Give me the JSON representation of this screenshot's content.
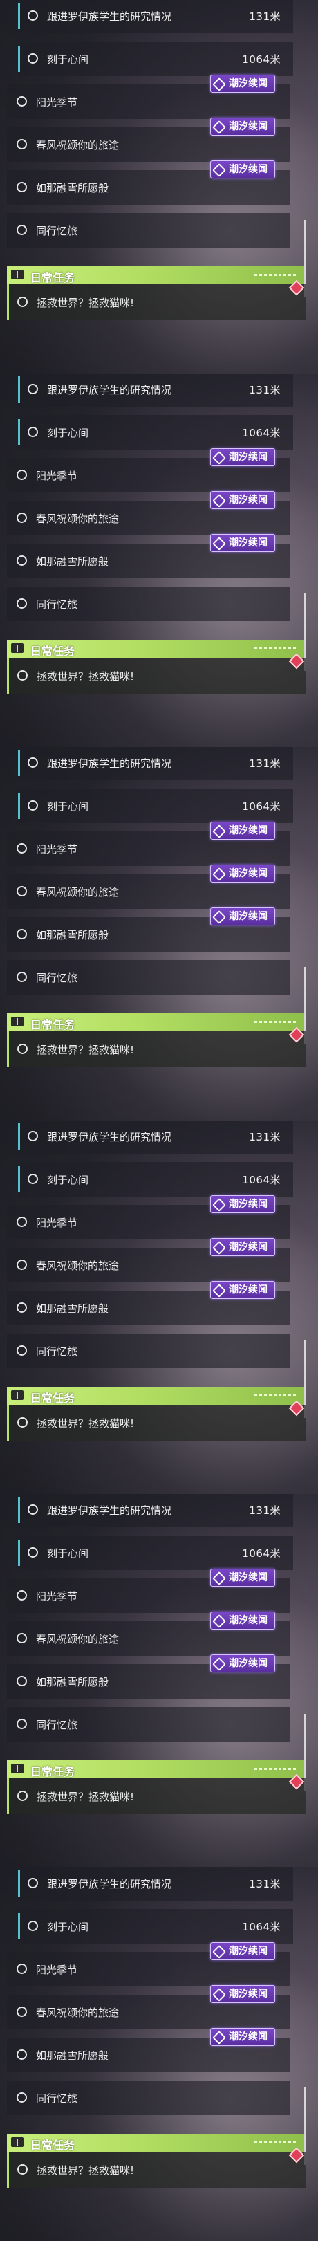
{
  "panels": [
    {
      "quests": [
        {
          "name": "跟进罗伊族学生的研究情况",
          "distance": "131米"
        },
        {
          "name": "刻于心间",
          "distance": "1064米"
        },
        {
          "name": "阳光季节"
        },
        {
          "name": "春风祝颂你的旅途"
        },
        {
          "name": "如那融雪所愿般"
        },
        {
          "name": "同行忆旅"
        }
      ],
      "badges": [
        "潮汐续闻",
        "潮汐续闻",
        "潮汐续闻"
      ],
      "daily": {
        "title": "日常任务",
        "task": "拯救世界？拯救猫咪!"
      }
    },
    {
      "quests": [
        {
          "name": "跟进罗伊族学生的研究情况",
          "distance": "131米"
        },
        {
          "name": "刻于心间",
          "distance": "1064米"
        },
        {
          "name": "阳光季节"
        },
        {
          "name": "春风祝颂你的旅途"
        },
        {
          "name": "如那融雪所愿般"
        },
        {
          "name": "同行忆旅"
        }
      ],
      "badges": [
        "潮汐续闻",
        "潮汐续闻",
        "潮汐续闻"
      ],
      "daily": {
        "title": "日常任务",
        "task": "拯救世界？拯救猫咪!"
      }
    },
    {
      "quests": [
        {
          "name": "跟进罗伊族学生的研究情况",
          "distance": "131米"
        },
        {
          "name": "刻于心间",
          "distance": "1064米"
        },
        {
          "name": "阳光季节"
        },
        {
          "name": "春风祝颂你的旅途"
        },
        {
          "name": "如那融雪所愿般"
        },
        {
          "name": "同行忆旅"
        }
      ],
      "badges": [
        "潮汐续闻",
        "潮汐续闻",
        "潮汐续闻"
      ],
      "daily": {
        "title": "日常任务",
        "task": "拯救世界？拯救猫咪!"
      }
    },
    {
      "quests": [
        {
          "name": "跟进罗伊族学生的研究情况",
          "distance": "131米"
        },
        {
          "name": "刻于心间",
          "distance": "1064米"
        },
        {
          "name": "阳光季节"
        },
        {
          "name": "春风祝颂你的旅途"
        },
        {
          "name": "如那融雪所愿般"
        },
        {
          "name": "同行忆旅"
        }
      ],
      "badges": [
        "潮汐续闻",
        "潮汐续闻",
        "潮汐续闻"
      ],
      "daily": {
        "title": "日常任务",
        "task": "拯救世界？拯救猫咪!"
      }
    },
    {
      "quests": [
        {
          "name": "跟进罗伊族学生的研究情况",
          "distance": "131米"
        },
        {
          "name": "刻于心间",
          "distance": "1064米"
        },
        {
          "name": "阳光季节"
        },
        {
          "name": "春风祝颂你的旅途"
        },
        {
          "name": "如那融雪所愿般"
        },
        {
          "name": "同行忆旅"
        }
      ],
      "badges": [
        "潮汐续闻",
        "潮汐续闻",
        "潮汐续闻"
      ],
      "daily": {
        "title": "日常任务",
        "task": "拯救世界？拯救猫咪!"
      }
    },
    {
      "quests": [
        {
          "name": "跟进罗伊族学生的研究情况",
          "distance": "131米"
        },
        {
          "name": "刻于心间",
          "distance": "1064米"
        },
        {
          "name": "阳光季节"
        },
        {
          "name": "春风祝颂你的旅途"
        },
        {
          "name": "如那融雪所愿般"
        },
        {
          "name": "同行忆旅"
        }
      ],
      "badges": [
        "潮汐续闻",
        "潮汐续闻",
        "潮汐续闻"
      ],
      "daily": {
        "title": "日常任务",
        "task": "拯救世界？拯救猫咪!"
      }
    }
  ],
  "colors": {
    "accent_cyan": "#57c2cf",
    "badge_purple": "#6a3cb5",
    "daily_green": "#b7e36a",
    "alert_red": "#e0405a"
  },
  "icons": {
    "quest_marker": "circle-icon",
    "badge": "tide-badge-icon",
    "daily": "daily-task-icon",
    "alert": "alert-diamond-icon"
  }
}
